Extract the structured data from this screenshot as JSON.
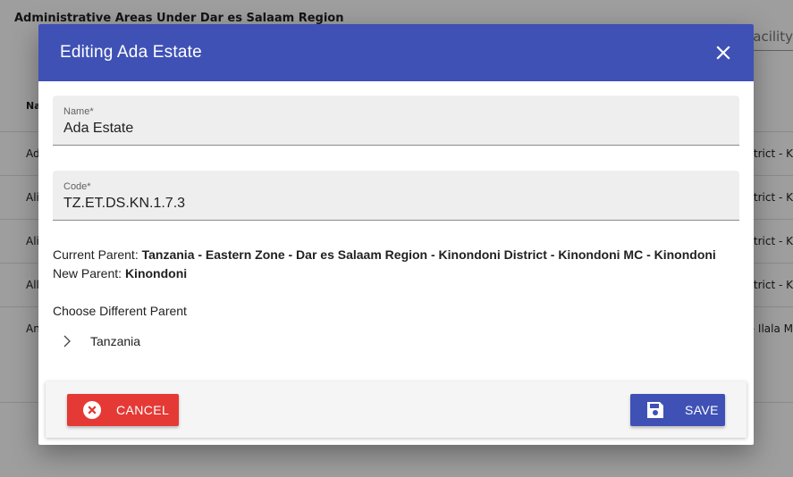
{
  "background": {
    "page_title": "Administrative Areas Under Dar es Salaam Region",
    "search_placeholder": "Facility",
    "column_header": "Na",
    "rows": [
      {
        "left": "Ad",
        "right": "istrict - K"
      },
      {
        "left": "Ali",
        "right": "istrict - K"
      },
      {
        "left": "Ali",
        "right": "istrict - K"
      },
      {
        "left": "All",
        "right": "istrict - K"
      },
      {
        "left": "An",
        "right": "- Ilala M"
      }
    ]
  },
  "dialog": {
    "title": "Editing Ada Estate",
    "close_icon": "close-icon",
    "name_field": {
      "label": "Name*",
      "value": "Ada Estate"
    },
    "code_field": {
      "label": "Code*",
      "value": "TZ.ET.DS.KN.1.7.3"
    },
    "current_parent_label": "Current Parent:",
    "current_parent_value": "Tanzania - Eastern Zone - Dar es Salaam Region - Kinondoni District - Kinondoni MC - Kinondoni",
    "new_parent_label": "New Parent:",
    "new_parent_value": "Kinondoni",
    "choose_label": "Choose Different Parent",
    "tree": [
      {
        "label": "Tanzania",
        "icon": "chevron-right-icon"
      }
    ],
    "cancel_label": "CANCEL",
    "save_label": "SAVE"
  },
  "colors": {
    "header": "#3f51b5",
    "cancel": "#e53935",
    "save": "#3f51b5"
  }
}
